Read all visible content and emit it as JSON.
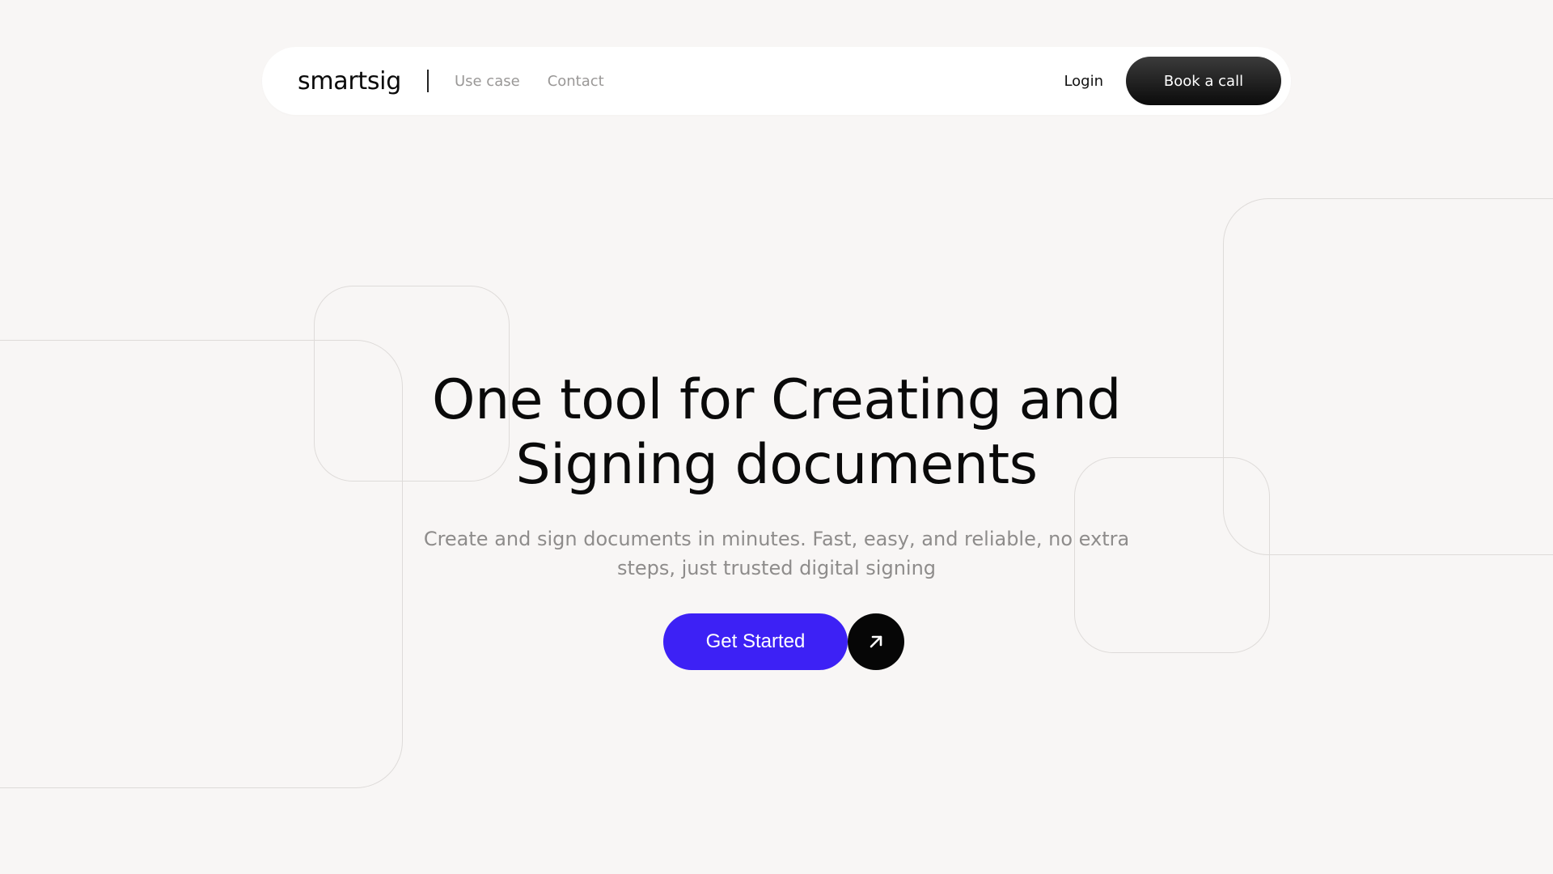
{
  "brand": {
    "name": "smartsig"
  },
  "nav": {
    "links": [
      "Use case",
      "Contact"
    ],
    "login_label": "Login",
    "cta_label": "Book a call"
  },
  "hero": {
    "title_line1": "One tool for Creating and",
    "title_line2": "Signing documents",
    "subtitle_line1": "Create and sign documents in minutes. Fast, easy, and reliable, no extra",
    "subtitle_line2": "steps, just trusted digital signing",
    "cta_label": "Get Started",
    "cta_icon": "arrow-up-right-icon"
  },
  "colors": {
    "background": "#f8f6f5",
    "accent": "#3d21f5",
    "dark": "#0a0a0a",
    "muted_text": "#8e8c8b"
  }
}
